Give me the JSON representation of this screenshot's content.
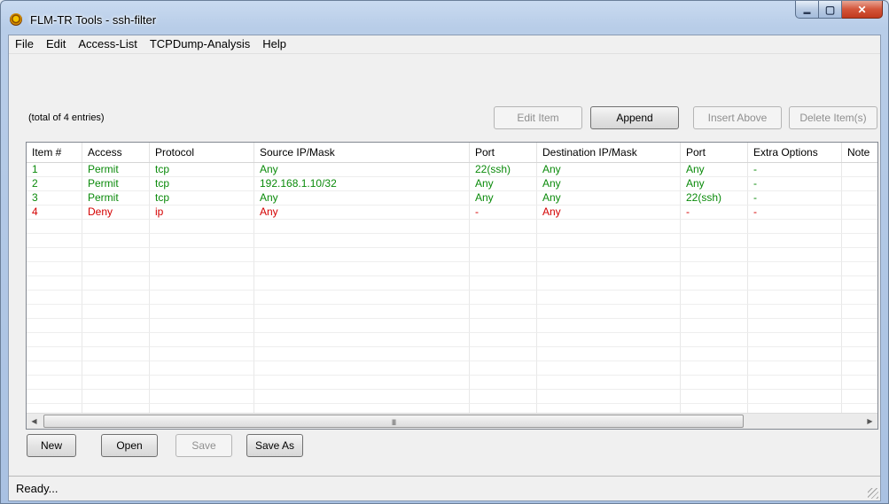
{
  "window": {
    "title": "FLM-TR Tools - ssh-filter",
    "min_glyph": "▬",
    "max_glyph": "▢",
    "close_glyph": "✕"
  },
  "menu": [
    "File",
    "Edit",
    "Access-List",
    "TCPDump-Analysis",
    "Help"
  ],
  "summary": {
    "total_text": "(total of 4 entries)"
  },
  "toolbar": {
    "edit_item": "Edit Item",
    "append": "Append",
    "insert_above": "Insert Above",
    "delete_items": "Delete Item(s)"
  },
  "table": {
    "columns": [
      "Item #",
      "Access",
      "Protocol",
      "Source IP/Mask",
      "Port",
      "Destination IP/Mask",
      "Port",
      "Extra Options",
      "Note"
    ],
    "rows": [
      {
        "access_type": "permit",
        "cells": [
          "1",
          "Permit",
          "tcp",
          "Any",
          "22(ssh)",
          "Any",
          "Any",
          "-",
          ""
        ]
      },
      {
        "access_type": "permit",
        "cells": [
          "2",
          "Permit",
          "tcp",
          "192.168.1.10/32",
          "Any",
          "Any",
          "Any",
          "-",
          ""
        ]
      },
      {
        "access_type": "permit",
        "cells": [
          "3",
          "Permit",
          "tcp",
          "Any",
          "Any",
          "Any",
          "22(ssh)",
          "-",
          ""
        ]
      },
      {
        "access_type": "deny",
        "cells": [
          "4",
          "Deny",
          "ip",
          "Any",
          "-",
          "Any",
          "-",
          "-",
          ""
        ]
      }
    ],
    "empty_rows": 15
  },
  "scrollbar": {
    "left_glyph": "◀",
    "right_glyph": "▶",
    "grip_glyph": "III"
  },
  "file_buttons": {
    "new": "New",
    "open": "Open",
    "save": "Save",
    "save_as": "Save As"
  },
  "status": {
    "text": "Ready..."
  },
  "colors": {
    "permit": "#0a8a0a",
    "deny": "#d40000"
  }
}
